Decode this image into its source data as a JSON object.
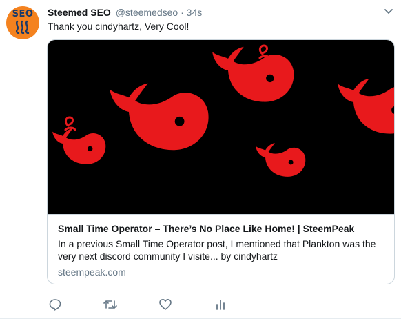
{
  "tweet": {
    "avatar_text": "SEO",
    "display_name": "Steemed SEO",
    "handle": "@steemedseo",
    "separator": "·",
    "time": "34s",
    "text": "Thank you cindyhartz, Very Cool!"
  },
  "card": {
    "title": "Small Time Operator – There’s No Place Like Home! | SteemPeak",
    "description": "In a previous Small Time Operator post, I mentioned that Plankton was the very next discord community I visite... by cindyhartz",
    "domain": "steempeak.com"
  },
  "colors": {
    "avatar_bg": "#f4821f",
    "whale_red": "#e8191c",
    "icon_gray": "#657786"
  },
  "icons": [
    "caret-down-icon",
    "reply-icon",
    "retweet-icon",
    "like-icon",
    "analytics-icon"
  ]
}
